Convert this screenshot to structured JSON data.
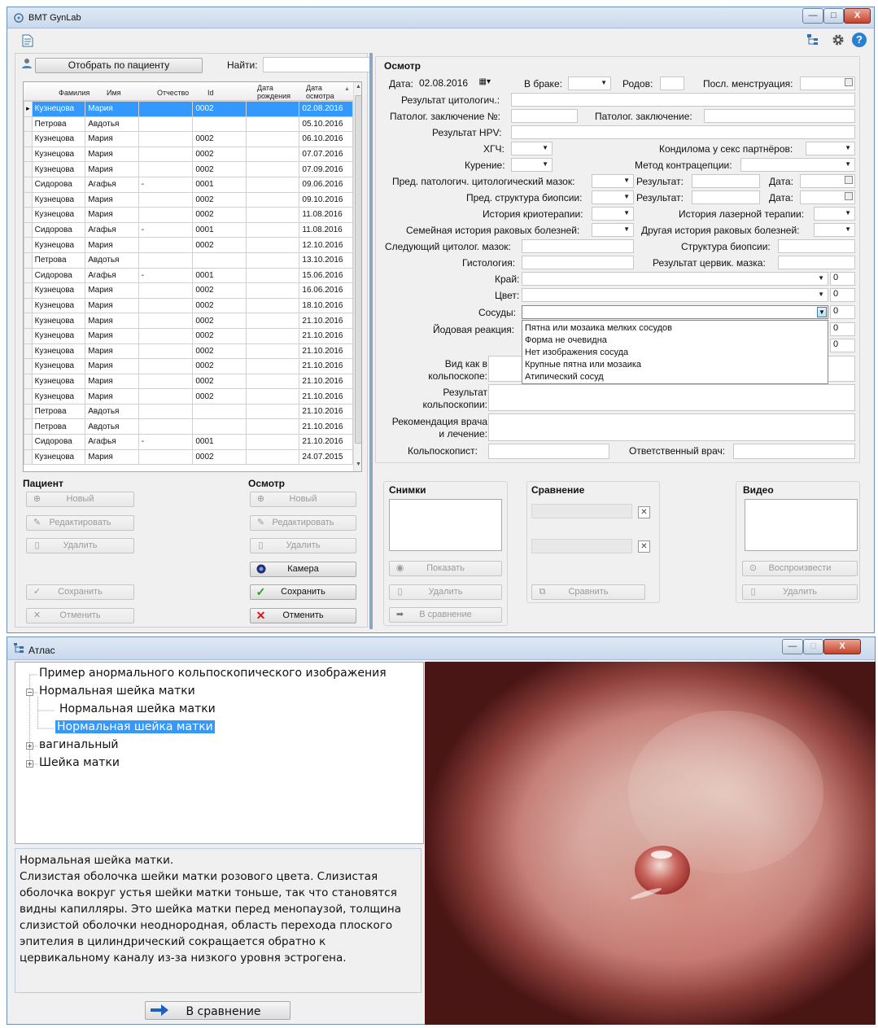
{
  "main_window": {
    "title": "BMT GynLab",
    "buttons": {
      "min": "—",
      "max": "□",
      "close": "X"
    }
  },
  "toolbar": {
    "left_icon": "new-document-icon",
    "right_icons": [
      "atlas-tree-icon",
      "gear-icon",
      "help-icon"
    ],
    "help_glyph": "?"
  },
  "patient_filter": {
    "button": "Отобрать по пациенту",
    "find_label": "Найти:",
    "find_value": ""
  },
  "grid": {
    "headers": [
      "Фамилия",
      "Имя",
      "Отчество",
      "Id",
      "Дата рождения",
      "Дата осмотра"
    ],
    "rows": [
      [
        "Кузнецова",
        "Мария",
        "",
        "0002",
        "",
        "02.08.2016"
      ],
      [
        "Петрова",
        "Авдотья",
        "",
        "",
        "",
        "05.10.2016"
      ],
      [
        "Кузнецова",
        "Мария",
        "",
        "0002",
        "",
        "06.10.2016"
      ],
      [
        "Кузнецова",
        "Мария",
        "",
        "0002",
        "",
        "07.07.2016"
      ],
      [
        "Кузнецова",
        "Мария",
        "",
        "0002",
        "",
        "07.09.2016"
      ],
      [
        "Сидорова",
        "Агафья",
        "-",
        "0001",
        "",
        "09.06.2016"
      ],
      [
        "Кузнецова",
        "Мария",
        "",
        "0002",
        "",
        "09.10.2016"
      ],
      [
        "Кузнецова",
        "Мария",
        "",
        "0002",
        "",
        "11.08.2016"
      ],
      [
        "Сидорова",
        "Агафья",
        "-",
        "0001",
        "",
        "11.08.2016"
      ],
      [
        "Кузнецова",
        "Мария",
        "",
        "0002",
        "",
        "12.10.2016"
      ],
      [
        "Петрова",
        "Авдотья",
        "",
        "",
        "",
        "13.10.2016"
      ],
      [
        "Сидорова",
        "Агафья",
        "-",
        "0001",
        "",
        "15.06.2016"
      ],
      [
        "Кузнецова",
        "Мария",
        "",
        "0002",
        "",
        "16.06.2016"
      ],
      [
        "Кузнецова",
        "Мария",
        "",
        "0002",
        "",
        "18.10.2016"
      ],
      [
        "Кузнецова",
        "Мария",
        "",
        "0002",
        "",
        "21.10.2016"
      ],
      [
        "Кузнецова",
        "Мария",
        "",
        "0002",
        "",
        "21.10.2016"
      ],
      [
        "Кузнецова",
        "Мария",
        "",
        "0002",
        "",
        "21.10.2016"
      ],
      [
        "Кузнецова",
        "Мария",
        "",
        "0002",
        "",
        "21.10.2016"
      ],
      [
        "Кузнецова",
        "Мария",
        "",
        "0002",
        "",
        "21.10.2016"
      ],
      [
        "Кузнецова",
        "Мария",
        "",
        "0002",
        "",
        "21.10.2016"
      ],
      [
        "Петрова",
        "Авдотья",
        "",
        "",
        "",
        "21.10.2016"
      ],
      [
        "Петрова",
        "Авдотья",
        "",
        "",
        "",
        "21.10.2016"
      ],
      [
        "Сидорова",
        "Агафья",
        "-",
        "0001",
        "",
        "21.10.2016"
      ],
      [
        "Кузнецова",
        "Мария",
        "",
        "0002",
        "",
        "24.07.2015"
      ]
    ]
  },
  "patient_group": {
    "title": "Пациент",
    "new": "Новый",
    "edit": "Редактировать",
    "delete": "Удалить",
    "save": "Сохранить",
    "cancel": "Отменить"
  },
  "exam_group": {
    "title": "Осмотр",
    "new": "Новый",
    "edit": "Редактировать",
    "delete": "Удалить",
    "camera": "Камера",
    "save": "Сохранить",
    "cancel": "Отменить"
  },
  "exam_form": {
    "title": "Осмотр",
    "date_label": "Дата:",
    "date_value": "02.08.2016",
    "married_label": "В браке:",
    "births_label": "Родов:",
    "menstruation_label": "Посл. менструация:",
    "cytology_result": "Результат цитологич.:",
    "patol_no": "Патолог. заключение №:",
    "patol_conclusion": "Патолог. заключение:",
    "hpv": "Результат HPV:",
    "hch": "ХГЧ:",
    "condyloma": "Кондилома у секс партнёров:",
    "smoking": "Курение:",
    "contraception": "Метод контрацепции:",
    "prev_smear": "Пред. патологич. цитологический мазок:",
    "result1": "Результат:",
    "date1": "Дата:",
    "prev_biopsy": "Пред. структура биопсии:",
    "result2": "Результат:",
    "date2": "Дата:",
    "cryo": "История криотерапии:",
    "laser": "История лазерной терапии:",
    "family_cancer": "Семейная история раковых болезней:",
    "other_cancer": "Другая история раковых болезней:",
    "next_smear": "Следующий цитолог. мазок:",
    "biopsy_structure": "Структура биопсии:",
    "histology": "Гистология:",
    "cervical_smear": "Результат цервик. мазка:",
    "edge": "Край:",
    "edge_val": "0",
    "color": "Цвет:",
    "color_val": "0",
    "vessels": "Сосуды:",
    "vessels_val": "0",
    "iodine": "Йодовая реакция:",
    "iodine_val": "0",
    "extra_val": "0",
    "colposcope_view": "Вид как в кольпоскопе:",
    "colposcopy_result": "Результат кольпоскопии:",
    "recommendation": "Рекомендация врача и лечение:",
    "colposcopist": "Кольпоскопист:",
    "responsible": "Ответственный врач:",
    "vessels_options": [
      "Пятна или мозаика мелких сосудов",
      "Форма не очевидна",
      "Нет изображения сосуда",
      "Крупные пятна или мозаика",
      "Атипический сосуд"
    ]
  },
  "snapshots": {
    "title": "Снимки",
    "show": "Показать",
    "delete": "Удалить",
    "to_compare": "В сравнение"
  },
  "compare": {
    "title": "Сравнение",
    "clear": "✕",
    "button": "Сравнить"
  },
  "video": {
    "title": "Видео",
    "play": "Воспроизвести",
    "delete": "Удалить"
  },
  "atlas": {
    "title": "Атлас",
    "tree": [
      {
        "label": "Пример анормального кольпоскопического изображения"
      },
      {
        "label": "Нормальная шейка матки",
        "expander": "−"
      },
      {
        "label": "Нормальная шейка матки"
      },
      {
        "label": "Нормальная шейка матки"
      },
      {
        "label": "вагинальный",
        "expander": "+"
      },
      {
        "label": "Шейка матки",
        "expander": "+"
      }
    ],
    "description_title": "Нормальная шейка матки.",
    "description": "Слизистая оболочка шейки матки розового цвета. Слизистая оболочка вокруг устья шейки матки тоньше, так что становятся видны капилляры. Это шейка матки перед менопаузой, толщина слизистой оболочки неоднородная, область перехода плоского эпителия в цилиндрический сокращается обратно к цервикальному каналу из-за низкого уровня эстрогена.",
    "compare_button": "В сравнение"
  }
}
